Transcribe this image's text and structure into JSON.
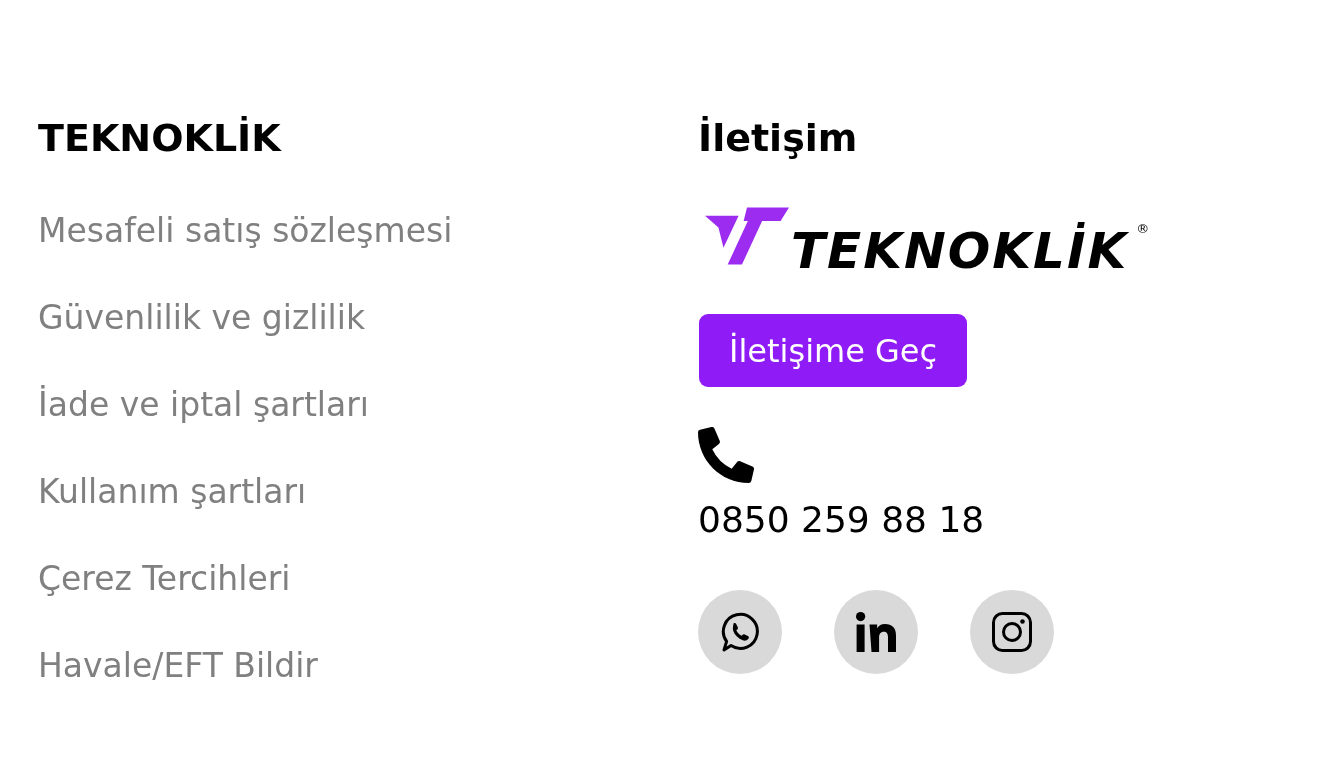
{
  "footer": {
    "menu": {
      "title": "TEKNOKLİK",
      "links": [
        "Mesafeli satış sözleşmesi",
        "Güvenlilik ve gizlilik",
        "İade ve iptal şartları",
        "Kullanım şartları",
        "Çerez Tercihleri",
        "Havale/EFT Bildir"
      ]
    },
    "contact": {
      "title": "İletişim",
      "logo": {
        "wordmark": "TEKNOKLİK",
        "registered": "®"
      },
      "button": "İletişime Geç",
      "phone": "0850 259 88 18",
      "social": [
        {
          "kind": "whatsapp"
        },
        {
          "kind": "linkedin"
        },
        {
          "kind": "instagram"
        }
      ]
    }
  }
}
